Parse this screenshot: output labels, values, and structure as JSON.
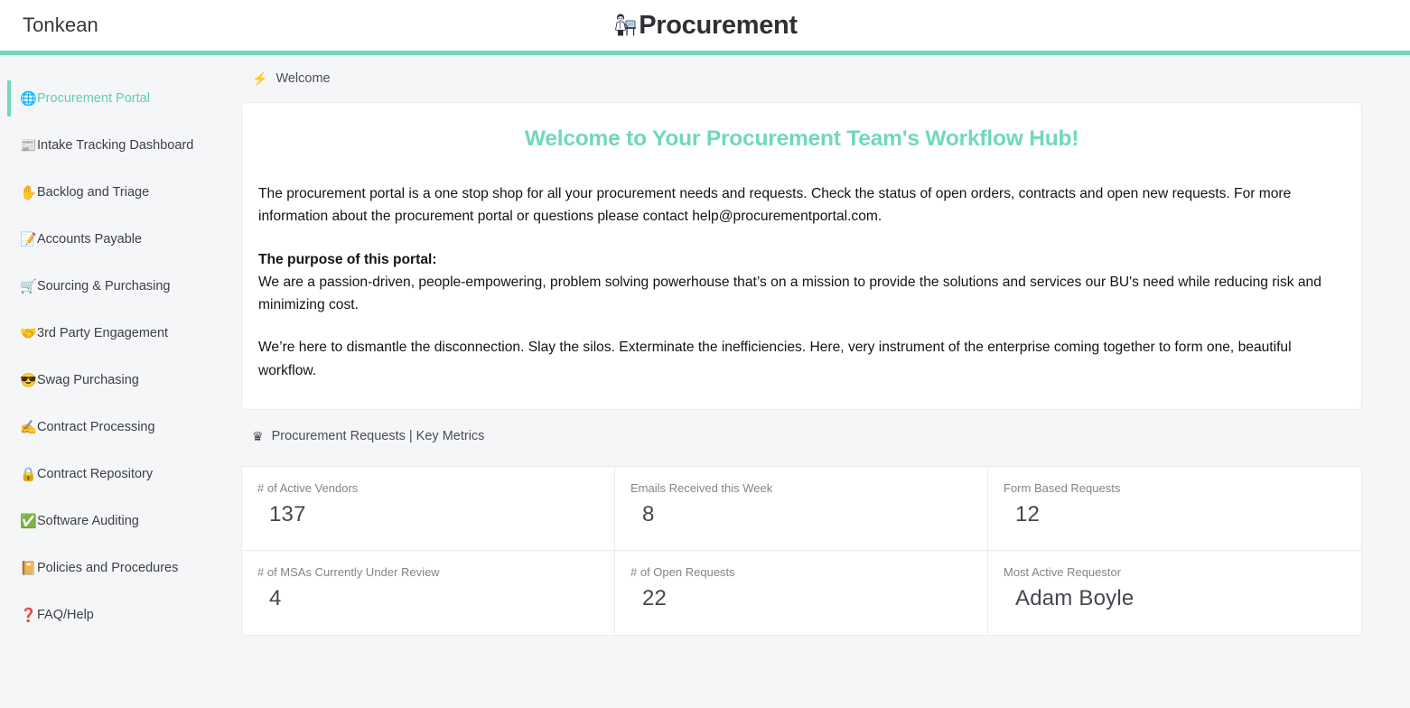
{
  "header": {
    "brand": "Tonkean",
    "title": "Procurement",
    "logo_icon": "person-at-desk-icon",
    "accent_color": "#6fd8bd"
  },
  "sidebar": {
    "items": [
      {
        "emoji": "🌐",
        "icon_name": "globe-icon",
        "label": "Procurement Portal",
        "active": true
      },
      {
        "emoji": "📰",
        "icon_name": "newspaper-icon",
        "label": "Intake Tracking Dashboard",
        "active": false
      },
      {
        "emoji": "✋",
        "icon_name": "raised-hand-icon",
        "label": "Backlog and Triage",
        "active": false
      },
      {
        "emoji": "📝",
        "icon_name": "memo-icon",
        "label": "Accounts Payable",
        "active": false
      },
      {
        "emoji": "🛒",
        "icon_name": "shopping-cart-icon",
        "label": "Sourcing & Purchasing",
        "active": false
      },
      {
        "emoji": "🤝",
        "icon_name": "handshake-icon",
        "label": "3rd Party Engagement",
        "active": false
      },
      {
        "emoji": "😎",
        "icon_name": "sunglasses-face-icon",
        "label": "Swag Purchasing",
        "active": false
      },
      {
        "emoji": "✍️",
        "icon_name": "writing-hand-icon",
        "label": "Contract Processing",
        "active": false
      },
      {
        "emoji": "🔒",
        "icon_name": "lock-icon",
        "label": "Contract Repository",
        "active": false
      },
      {
        "emoji": "✅",
        "icon_name": "check-mark-button-icon",
        "label": "Software Auditing",
        "active": false
      },
      {
        "emoji": "📔",
        "icon_name": "notebook-icon",
        "label": "Policies and Procedures",
        "active": false
      },
      {
        "emoji": "❓",
        "icon_name": "question-mark-icon",
        "label": "FAQ/Help",
        "active": false
      }
    ]
  },
  "welcome_section": {
    "icon": "⚡",
    "icon_name": "lightning-bolt-icon",
    "label": "Welcome",
    "heading": "Welcome to Your Procurement Team's Workflow Hub!",
    "heading_color": "#6fd8bd",
    "paragraph_1": "The procurement portal is a one stop shop for all your procurement needs and requests. Check the status of open orders, contracts and open new requests. For more information about the procurement portal or questions please contact help@procurementportal.com.",
    "purpose_title": "The purpose of this portal:",
    "paragraph_2": "We are a passion-driven, people-empowering, problem solving powerhouse that’s on a mission to provide the solutions and services our BU's need while reducing risk and minimizing cost.",
    "paragraph_3": "We’re here to dismantle the disconnection. Slay the silos. Exterminate the inefficiencies. Here, very instrument of the enterprise coming together to form one, beautiful workflow."
  },
  "metrics_section": {
    "icon": "♛",
    "icon_name": "crown-icon",
    "label": "Procurement Requests | Key Metrics",
    "metrics": [
      {
        "label": "# of Active Vendors",
        "value": "137"
      },
      {
        "label": "Emails Received this Week",
        "value": "8"
      },
      {
        "label": "Form Based Requests",
        "value": "12"
      },
      {
        "label": "# of MSAs Currently Under Review",
        "value": "4"
      },
      {
        "label": "# of Open Requests",
        "value": "22"
      },
      {
        "label": "Most Active Requestor",
        "value": "Adam Boyle"
      }
    ]
  }
}
